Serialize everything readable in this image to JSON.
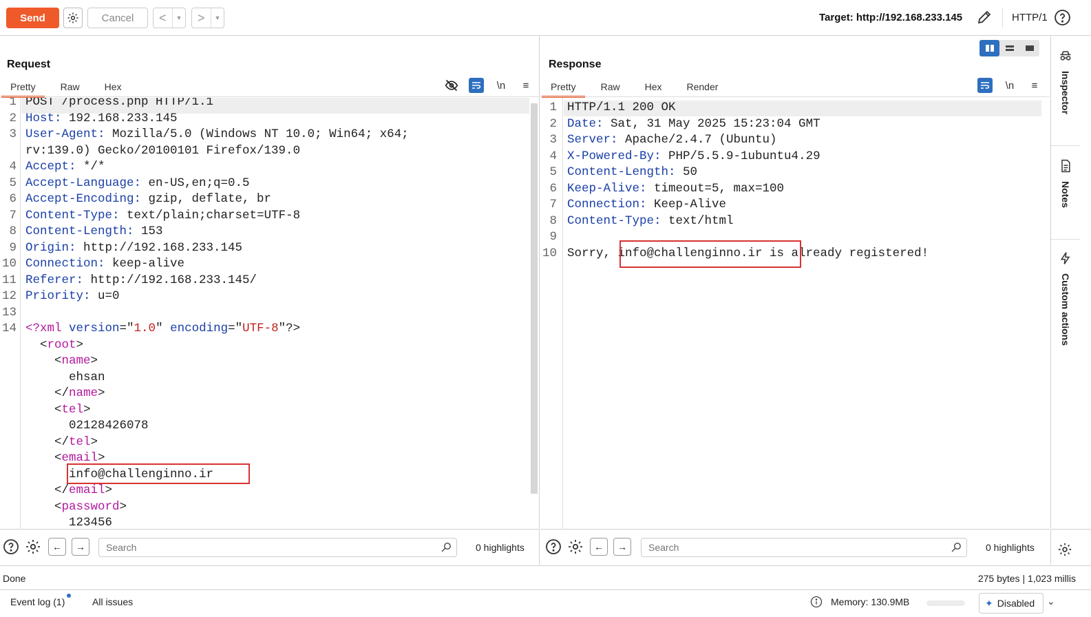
{
  "toolbar": {
    "send_label": "Send",
    "cancel_label": "Cancel",
    "target_label": "Target: http://192.168.233.145",
    "http_version": "HTTP/1"
  },
  "request": {
    "title": "Request",
    "tabs": [
      "Pretty",
      "Raw",
      "Hex"
    ],
    "active_tab": "Pretty",
    "lines": [
      {
        "n": "1",
        "parts": [
          [
            "",
            "POST /process.php HTTP/1.1"
          ]
        ]
      },
      {
        "n": "2",
        "parts": [
          [
            "hk",
            "Host:"
          ],
          [
            "",
            " 192.168.233.145"
          ]
        ]
      },
      {
        "n": "3",
        "parts": [
          [
            "hk",
            "User-Agent:"
          ],
          [
            "",
            " Mozilla/5.0 (Windows NT 10.0; Win64; x64;"
          ]
        ]
      },
      {
        "n": "",
        "parts": [
          [
            "",
            "rv:139.0) Gecko/20100101 Firefox/139.0"
          ]
        ]
      },
      {
        "n": "4",
        "parts": [
          [
            "hk",
            "Accept:"
          ],
          [
            "",
            " */*"
          ]
        ]
      },
      {
        "n": "5",
        "parts": [
          [
            "hk",
            "Accept-Language:"
          ],
          [
            "",
            " en-US,en;q=0.5"
          ]
        ]
      },
      {
        "n": "6",
        "parts": [
          [
            "hk",
            "Accept-Encoding:"
          ],
          [
            "",
            " gzip, deflate, br"
          ]
        ]
      },
      {
        "n": "7",
        "parts": [
          [
            "hk",
            "Content-Type:"
          ],
          [
            "",
            " text/plain;charset=UTF-8"
          ]
        ]
      },
      {
        "n": "8",
        "parts": [
          [
            "hk",
            "Content-Length:"
          ],
          [
            "",
            " 153"
          ]
        ]
      },
      {
        "n": "9",
        "parts": [
          [
            "hk",
            "Origin:"
          ],
          [
            "",
            " http://192.168.233.145"
          ]
        ]
      },
      {
        "n": "10",
        "parts": [
          [
            "hk",
            "Connection:"
          ],
          [
            "",
            " keep-alive"
          ]
        ]
      },
      {
        "n": "11",
        "parts": [
          [
            "hk",
            "Referer:"
          ],
          [
            "",
            " http://192.168.233.145/"
          ]
        ]
      },
      {
        "n": "12",
        "parts": [
          [
            "hk",
            "Priority:"
          ],
          [
            "",
            " u=0"
          ]
        ]
      },
      {
        "n": "13",
        "parts": [
          [
            "",
            ""
          ]
        ]
      },
      {
        "n": "14",
        "parts": [
          [
            "tg",
            "<?xml"
          ],
          [
            "hk",
            " version"
          ],
          [
            "",
            "=\""
          ],
          [
            "st",
            "1.0"
          ],
          [
            "",
            "\""
          ],
          [
            "hk",
            " encoding"
          ],
          [
            "",
            "=\""
          ],
          [
            "st",
            "UTF-8"
          ],
          [
            "",
            "\"?>"
          ]
        ]
      },
      {
        "n": "",
        "parts": [
          [
            "",
            "  <"
          ],
          [
            "tg",
            "root"
          ],
          [
            "",
            ">"
          ]
        ]
      },
      {
        "n": "",
        "parts": [
          [
            "",
            "    <"
          ],
          [
            "tg",
            "name"
          ],
          [
            "",
            ">"
          ]
        ]
      },
      {
        "n": "",
        "parts": [
          [
            "",
            "      ehsan"
          ]
        ]
      },
      {
        "n": "",
        "parts": [
          [
            "",
            "    </"
          ],
          [
            "tg",
            "name"
          ],
          [
            "",
            ">"
          ]
        ]
      },
      {
        "n": "",
        "parts": [
          [
            "",
            "    <"
          ],
          [
            "tg",
            "tel"
          ],
          [
            "",
            ">"
          ]
        ]
      },
      {
        "n": "",
        "parts": [
          [
            "",
            "      02128426078"
          ]
        ]
      },
      {
        "n": "",
        "parts": [
          [
            "",
            "    </"
          ],
          [
            "tg",
            "tel"
          ],
          [
            "",
            ">"
          ]
        ]
      },
      {
        "n": "",
        "parts": [
          [
            "",
            "    <"
          ],
          [
            "tg",
            "email"
          ],
          [
            "",
            ">"
          ]
        ]
      },
      {
        "n": "",
        "parts": [
          [
            "",
            "      info@challenginno.ir"
          ]
        ]
      },
      {
        "n": "",
        "parts": [
          [
            "",
            "    </"
          ],
          [
            "tg",
            "email"
          ],
          [
            "",
            ">"
          ]
        ]
      },
      {
        "n": "",
        "parts": [
          [
            "",
            "    <"
          ],
          [
            "tg",
            "password"
          ],
          [
            "",
            ">"
          ]
        ]
      },
      {
        "n": "",
        "parts": [
          [
            "",
            "      123456"
          ]
        ]
      }
    ]
  },
  "response": {
    "title": "Response",
    "tabs": [
      "Pretty",
      "Raw",
      "Hex",
      "Render"
    ],
    "active_tab": "Pretty",
    "lines": [
      {
        "n": "1",
        "parts": [
          [
            "",
            "HTTP/1.1 200 OK"
          ]
        ]
      },
      {
        "n": "2",
        "parts": [
          [
            "hk",
            "Date:"
          ],
          [
            "",
            " Sat, 31 May 2025 15:23:04 GMT"
          ]
        ]
      },
      {
        "n": "3",
        "parts": [
          [
            "hk",
            "Server:"
          ],
          [
            "",
            " Apache/2.4.7 (Ubuntu)"
          ]
        ]
      },
      {
        "n": "4",
        "parts": [
          [
            "hk",
            "X-Powered-By:"
          ],
          [
            "",
            " PHP/5.5.9-1ubuntu4.29"
          ]
        ]
      },
      {
        "n": "5",
        "parts": [
          [
            "hk",
            "Content-Length:"
          ],
          [
            "",
            " 50"
          ]
        ]
      },
      {
        "n": "6",
        "parts": [
          [
            "hk",
            "Keep-Alive:"
          ],
          [
            "",
            " timeout=5, max=100"
          ]
        ]
      },
      {
        "n": "7",
        "parts": [
          [
            "hk",
            "Connection:"
          ],
          [
            "",
            " Keep-Alive"
          ]
        ]
      },
      {
        "n": "8",
        "parts": [
          [
            "hk",
            "Content-Type:"
          ],
          [
            "",
            " text/html"
          ]
        ]
      },
      {
        "n": "9",
        "parts": [
          [
            "",
            ""
          ]
        ]
      },
      {
        "n": "10",
        "parts": [
          [
            "",
            "Sorry, info@challenginno.ir is already registered!"
          ]
        ]
      }
    ]
  },
  "search": {
    "placeholder": "Search",
    "request_highlights": "0 highlights",
    "response_highlights": "0 highlights"
  },
  "rail": {
    "items": [
      "Inspector",
      "Notes",
      "Custom actions"
    ]
  },
  "status": {
    "state": "Done",
    "size_time": "275 bytes | 1,023 millis",
    "event_log": "Event log (1)",
    "all_issues": "All issues",
    "memory": "Memory: 130.9MB",
    "ai_state": "Disabled"
  },
  "colors": {
    "accent": "#ee5a2a",
    "header_key": "#1a3fa8",
    "xml_tag": "#b2189d",
    "xml_string": "#c22121",
    "highlight_box": "#d93232",
    "tool_blue": "#2e6fbf"
  }
}
